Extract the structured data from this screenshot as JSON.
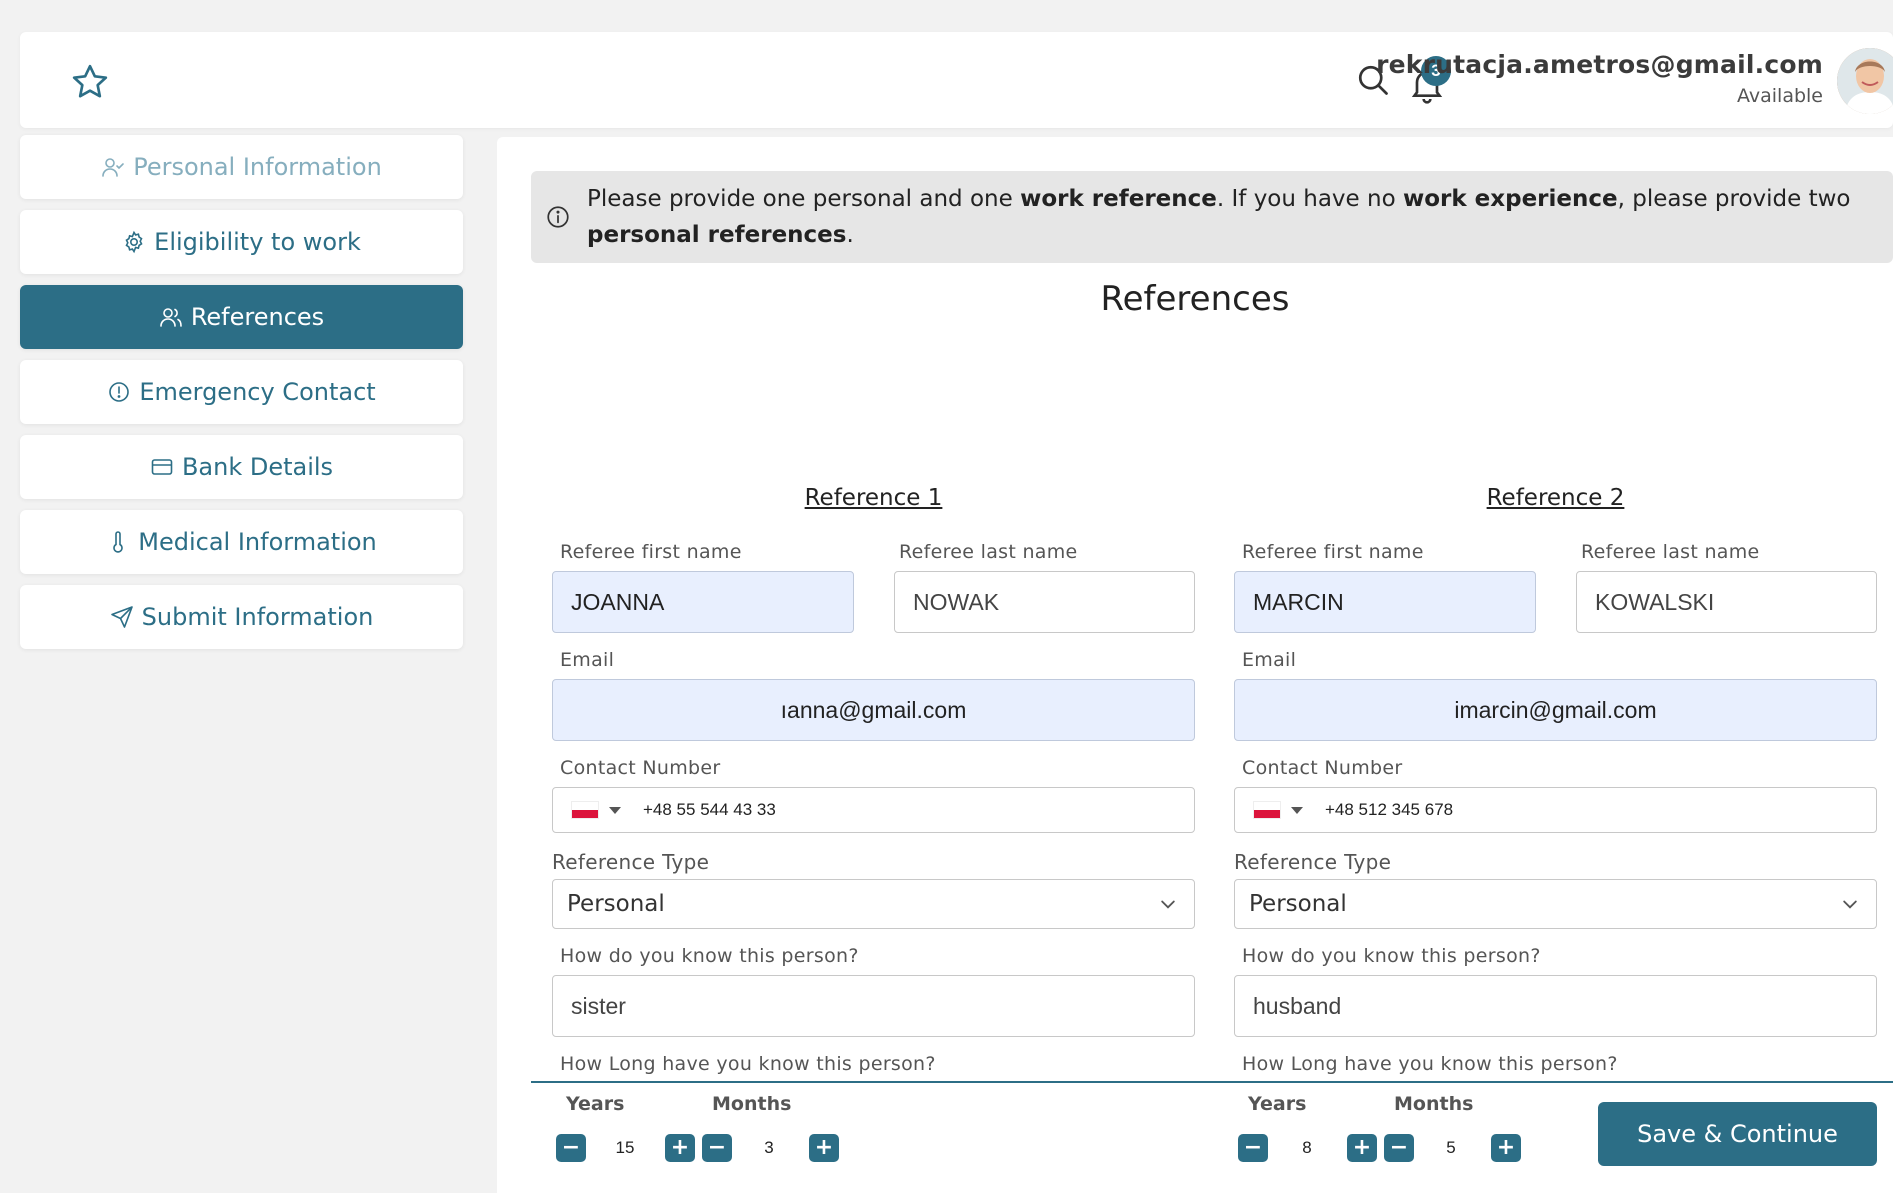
{
  "header": {
    "user_email": "rekrutacja.ametros@gmail.com",
    "user_status": "Available",
    "notification_count": "3"
  },
  "sidebar": {
    "items": [
      {
        "label": "Personal Information",
        "icon": "user-check-icon",
        "state": "faded"
      },
      {
        "label": "Eligibility to work",
        "icon": "gear-icon",
        "state": "normal"
      },
      {
        "label": "References",
        "icon": "users-icon",
        "state": "active"
      },
      {
        "label": "Emergency Contact",
        "icon": "alert-circle-icon",
        "state": "normal"
      },
      {
        "label": "Bank Details",
        "icon": "credit-card-icon",
        "state": "normal"
      },
      {
        "label": "Medical  Information",
        "icon": "thermometer-icon",
        "state": "normal"
      },
      {
        "label": "Submit Information",
        "icon": "send-icon",
        "state": "normal"
      }
    ]
  },
  "banner": {
    "t1": "Please provide one personal and one ",
    "b1": "work reference",
    "t2": ". If you have no ",
    "b2": "work experience",
    "t3": ", please provide two ",
    "b3": "personal references",
    "t4": "."
  },
  "main": {
    "title": "References",
    "references": [
      {
        "heading": "Reference 1",
        "first_name_label": "Referee first name",
        "first_name": "JOANNA",
        "last_name_label": "Referee last name",
        "last_name": "NOWAK",
        "email_label": "Email",
        "email": "ıanna@gmail.com",
        "phone_label": "Contact Number",
        "phone": "+48 55 544 43 33",
        "type_label": "Reference Type",
        "type": "Personal",
        "know_label": "How do you know this person?",
        "know": "sister",
        "duration_label": "How Long have you know this person?",
        "years_label": "Years",
        "months_label": "Months",
        "years": "15",
        "months": "3"
      },
      {
        "heading": "Reference 2",
        "first_name_label": "Referee first name",
        "first_name": "MARCIN",
        "last_name_label": "Referee last name",
        "last_name": "KOWALSKI",
        "email_label": "Email",
        "email": "imarcin@gmail.com",
        "phone_label": "Contact Number",
        "phone": "+48 512 345 678",
        "type_label": "Reference Type",
        "type": "Personal",
        "know_label": "How do you know this person?",
        "know": "husband",
        "duration_label": "How Long have you know this person?",
        "years_label": "Years",
        "months_label": "Months",
        "years": "8",
        "months": "5"
      }
    ],
    "save_label": "Save & Continue"
  },
  "colors": {
    "accent": "#2c6e86",
    "filled_field": "#e8effe",
    "banner_bg": "#e6e6e6"
  }
}
